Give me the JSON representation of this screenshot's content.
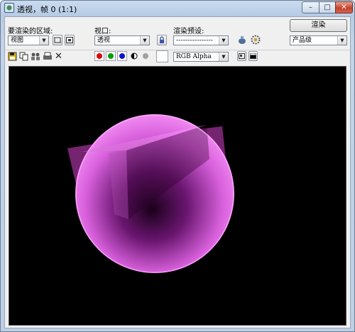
{
  "window": {
    "title": "透视，帧 0 (1:1)",
    "controls": {
      "minimize": "–",
      "maximize": "□",
      "close": "✕"
    }
  },
  "toolbar": {
    "area_label": "要渲染的区域:",
    "area_value": "视图",
    "viewport_label": "视口:",
    "viewport_value": "透视",
    "preset_label": "渲染预设:",
    "preset_value": "----------------",
    "render_button": "渲染",
    "quality_value": "产品级",
    "channel_value": "RGB Alpha"
  },
  "channels": {
    "red_color": "#e00000",
    "green_color": "#00a000",
    "blue_color": "#1010d0",
    "alpha_color": "#a0a0a0"
  },
  "scene": {
    "background": "#000000",
    "sphere_color": "#ff7dff",
    "box_color": "#a0329a"
  }
}
